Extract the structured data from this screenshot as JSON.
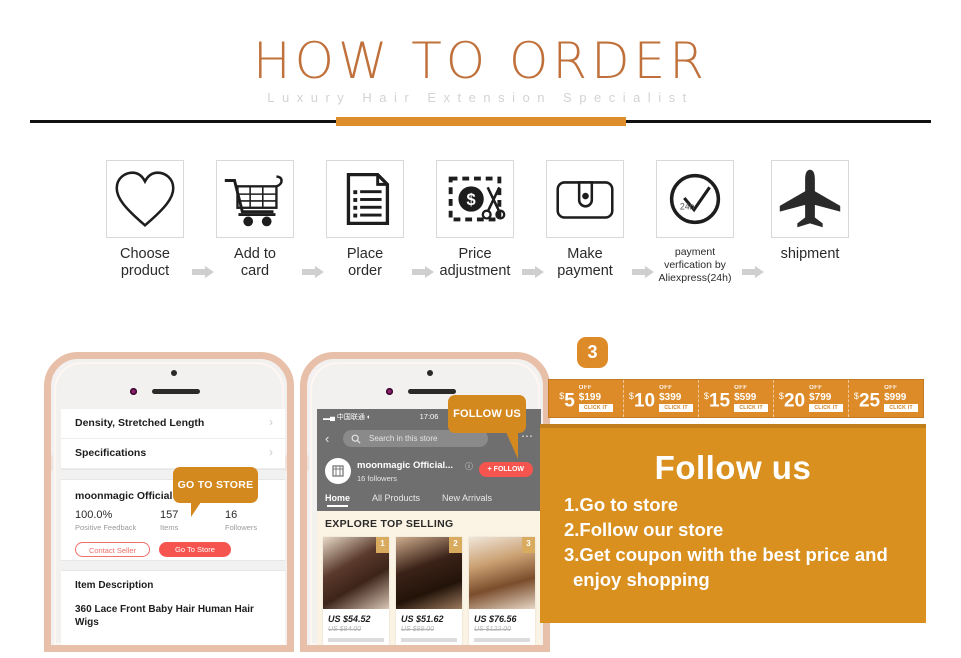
{
  "header": {
    "title": "HOW TO ORDER",
    "subtitle": "Luxury Hair Extension Specialist",
    "accent_color": "#de8d2b",
    "title_color": "#c0703a"
  },
  "steps": [
    {
      "label_line1": "Choose",
      "label_line2": "product",
      "icon": "heart-icon"
    },
    {
      "label_line1": "Add to",
      "label_line2": "card",
      "icon": "shopping-cart-icon"
    },
    {
      "label_line1": "Place",
      "label_line2": "order",
      "icon": "document-list-icon"
    },
    {
      "label_line1": "Price",
      "label_line2": "adjustment",
      "icon": "price-cut-dollar-icon"
    },
    {
      "label_line1": "Make",
      "label_line2": "payment",
      "icon": "wallet-icon"
    },
    {
      "label_line1": "payment",
      "label_line2": "verfication by",
      "label_line3": "Aliexpress(24h)",
      "icon": "clock-check-24h-icon",
      "clock_label": "24h",
      "small": true
    },
    {
      "label_line1": "shipment",
      "label_line2": "",
      "icon": "airplane-icon"
    }
  ],
  "phone1": {
    "rows": [
      {
        "label": "Density, Stretched Length",
        "chevron": "›"
      },
      {
        "label": "Specifications",
        "chevron": "›"
      }
    ],
    "store_name": "moonmagic Official Store",
    "stats": [
      {
        "value": "100.0%",
        "key": "Positive Feedback"
      },
      {
        "value": "157",
        "key": "Items"
      },
      {
        "value": "16",
        "key": "Followers"
      }
    ],
    "contact_seller_label": "Contact Seller",
    "go_to_store_label": "Go To Store",
    "description_heading": "Item Description",
    "description_text": "360 Lace Front Baby Hair Human Hair Wigs",
    "callout": "GO TO STORE"
  },
  "phone2": {
    "status_carrier": "中国联通",
    "status_time": "17:06",
    "search_placeholder": "Search in this store",
    "shop_name": "moonmagic Official...",
    "followers": "16  followers",
    "follow_button": "+ FOLLOW",
    "tabs": [
      {
        "label": "Home",
        "active": true
      },
      {
        "label": "All Products",
        "active": false
      },
      {
        "label": "New Arrivals",
        "active": false
      }
    ],
    "section_title": "EXPLORE TOP SELLING",
    "products": [
      {
        "rank": "1",
        "price": "US $54.52",
        "old_price": "US $84.00"
      },
      {
        "rank": "2",
        "price": "US $51.62",
        "old_price": "US $89.00"
      },
      {
        "rank": "3",
        "price": "US $76.56",
        "old_price": "US $122.00"
      }
    ],
    "callout": "FOLLOW US"
  },
  "right_panel": {
    "badge": "3",
    "coupons": [
      {
        "currency": "$",
        "amount": "5",
        "off": "OFF",
        "min": "$199",
        "cta": "CLICK IT"
      },
      {
        "currency": "$",
        "amount": "10",
        "off": "OFF",
        "min": "$399",
        "cta": "CLICK IT"
      },
      {
        "currency": "$",
        "amount": "15",
        "off": "OFF",
        "min": "$599",
        "cta": "CLICK IT"
      },
      {
        "currency": "$",
        "amount": "20",
        "off": "OFF",
        "min": "$799",
        "cta": "CLICK IT"
      },
      {
        "currency": "$",
        "amount": "25",
        "off": "OFF",
        "min": "$999",
        "cta": "CLICK IT"
      }
    ],
    "follow_title": "Follow us",
    "follow_steps": [
      "1.Go to store",
      "2.Follow our store",
      "3.Get coupon with the best price and",
      "enjoy shopping"
    ],
    "panel_color": "#d9901f"
  }
}
